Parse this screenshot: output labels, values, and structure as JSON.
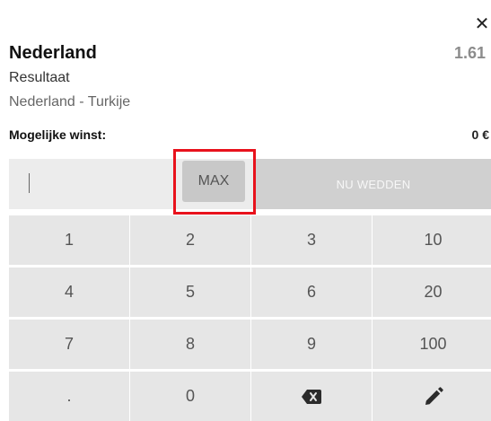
{
  "header": {
    "team": "Nederland",
    "odds": "1.61",
    "market": "Resultaat",
    "match": "Nederland - Turkije",
    "close_icon": "close-icon"
  },
  "winnings": {
    "label": "Mogelijke winst:",
    "value": "0 €"
  },
  "stake": {
    "value": "",
    "max_label": "MAX",
    "bet_label": "NU WEDDEN"
  },
  "keypad": {
    "rows": [
      [
        "1",
        "2",
        "3",
        "10"
      ],
      [
        "4",
        "5",
        "6",
        "20"
      ],
      [
        "7",
        "8",
        "9",
        "100"
      ],
      [
        ".",
        "0",
        "backspace-icon",
        "edit-icon"
      ]
    ]
  },
  "colors": {
    "highlight": "#e8121c",
    "key_bg": "#e6e6e6",
    "disabled_button": "#d0d0d0"
  }
}
